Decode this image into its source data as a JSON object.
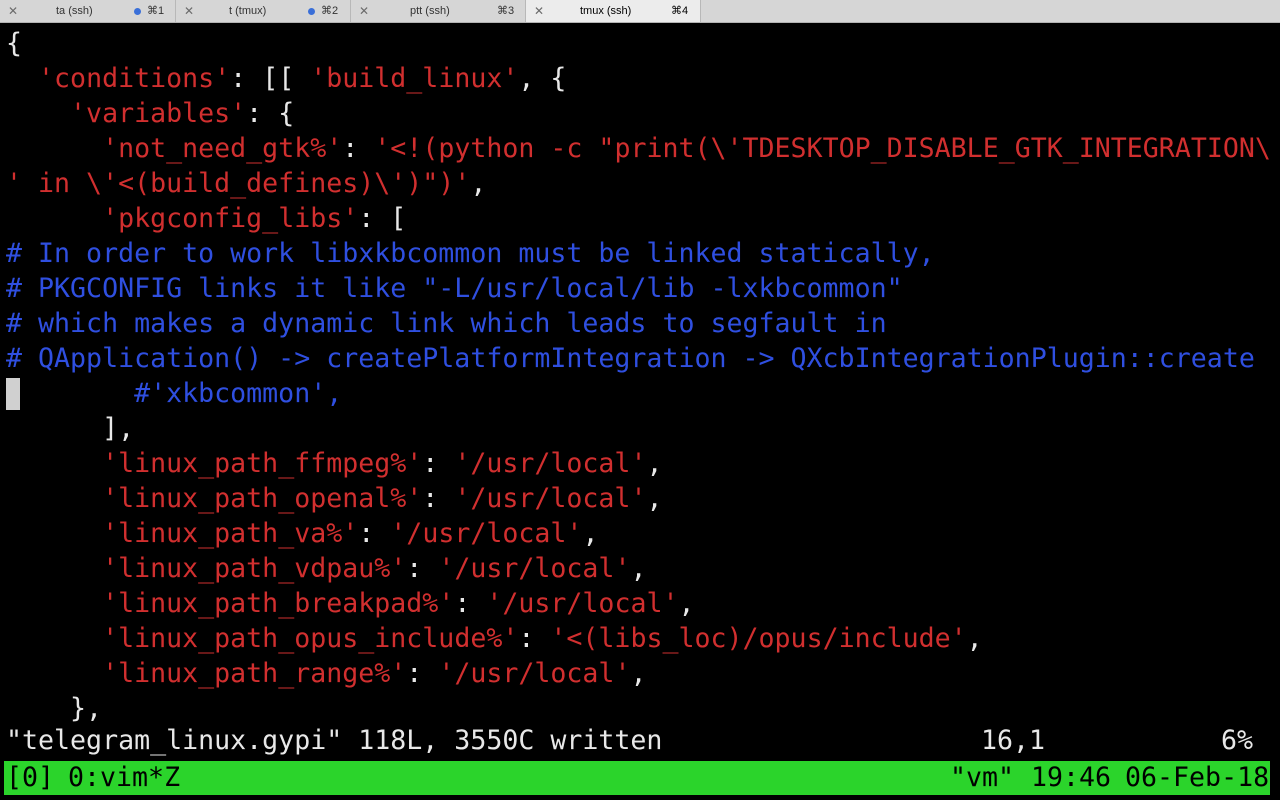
{
  "tabs": [
    {
      "title": "ta (ssh)",
      "shortcut": "⌘1",
      "dot": true
    },
    {
      "title": "t (tmux)",
      "shortcut": "⌘2",
      "dot": true
    },
    {
      "title": "ptt (ssh)",
      "shortcut": "⌘3",
      "dot": false
    },
    {
      "title": "tmux (ssh)",
      "shortcut": "⌘4",
      "dot": false,
      "active": true
    }
  ],
  "colors": {
    "string_red": "#d12f2f",
    "comment_blue": "#2f4fe0",
    "tmux_green": "#2bd42b",
    "tab_dot_blue": "#3a6fd8"
  },
  "icons": {
    "tab_close": "close-icon",
    "activity": "activity-dot-icon"
  },
  "editor": {
    "lines": [
      {
        "segments": [
          {
            "text": "{",
            "c": "white"
          }
        ]
      },
      {
        "segments": [
          {
            "text": "  ",
            "c": "white"
          },
          {
            "text": "'conditions'",
            "c": "red"
          },
          {
            "text": ": [[ ",
            "c": "white"
          },
          {
            "text": "'build_linux'",
            "c": "red"
          },
          {
            "text": ", {",
            "c": "white"
          }
        ]
      },
      {
        "segments": [
          {
            "text": "    ",
            "c": "white"
          },
          {
            "text": "'variables'",
            "c": "red"
          },
          {
            "text": ": {",
            "c": "white"
          }
        ]
      },
      {
        "segments": [
          {
            "text": "      ",
            "c": "white"
          },
          {
            "text": "'not_need_gtk%'",
            "c": "red"
          },
          {
            "text": ": ",
            "c": "white"
          },
          {
            "text": "'<!(python -c \"print(\\'TDESKTOP_DISABLE_GTK_INTEGRATION\\",
            "c": "red"
          }
        ]
      },
      {
        "segments": [
          {
            "text": "' in \\'<(build_defines)\\')\")'",
            "c": "red"
          },
          {
            "text": ",",
            "c": "white"
          }
        ]
      },
      {
        "segments": [
          {
            "text": "      ",
            "c": "white"
          },
          {
            "text": "'pkgconfig_libs'",
            "c": "red"
          },
          {
            "text": ": [",
            "c": "white"
          }
        ]
      },
      {
        "segments": [
          {
            "text": "# In order to work libxkbcommon must be linked statically,",
            "c": "blue"
          }
        ]
      },
      {
        "segments": [
          {
            "text": "# PKGCONFIG links it like \"-L/usr/local/lib -lxkbcommon\"",
            "c": "blue"
          }
        ]
      },
      {
        "segments": [
          {
            "text": "# which makes a dynamic link which leads to segfault in",
            "c": "blue"
          }
        ]
      },
      {
        "segments": [
          {
            "text": "# QApplication() -> createPlatformIntegration -> QXcbIntegrationPlugin::create",
            "c": "blue"
          }
        ]
      },
      {
        "segments": [
          {
            "text": "        #'xkbcommon',",
            "c": "blue"
          }
        ]
      },
      {
        "segments": [
          {
            "text": "      ],",
            "c": "white"
          }
        ]
      },
      {
        "segments": [
          {
            "text": "      ",
            "c": "white"
          },
          {
            "text": "'linux_path_ffmpeg%'",
            "c": "red"
          },
          {
            "text": ": ",
            "c": "white"
          },
          {
            "text": "'/usr/local'",
            "c": "red"
          },
          {
            "text": ",",
            "c": "white"
          }
        ]
      },
      {
        "segments": [
          {
            "text": "      ",
            "c": "white"
          },
          {
            "text": "'linux_path_openal%'",
            "c": "red"
          },
          {
            "text": ": ",
            "c": "white"
          },
          {
            "text": "'/usr/local'",
            "c": "red"
          },
          {
            "text": ",",
            "c": "white"
          }
        ]
      },
      {
        "segments": [
          {
            "text": "      ",
            "c": "white"
          },
          {
            "text": "'linux_path_va%'",
            "c": "red"
          },
          {
            "text": ": ",
            "c": "white"
          },
          {
            "text": "'/usr/local'",
            "c": "red"
          },
          {
            "text": ",",
            "c": "white"
          }
        ]
      },
      {
        "segments": [
          {
            "text": "      ",
            "c": "white"
          },
          {
            "text": "'linux_path_vdpau%'",
            "c": "red"
          },
          {
            "text": ": ",
            "c": "white"
          },
          {
            "text": "'/usr/local'",
            "c": "red"
          },
          {
            "text": ",",
            "c": "white"
          }
        ]
      },
      {
        "segments": [
          {
            "text": "      ",
            "c": "white"
          },
          {
            "text": "'linux_path_breakpad%'",
            "c": "red"
          },
          {
            "text": ": ",
            "c": "white"
          },
          {
            "text": "'/usr/local'",
            "c": "red"
          },
          {
            "text": ",",
            "c": "white"
          }
        ]
      },
      {
        "segments": [
          {
            "text": "      ",
            "c": "white"
          },
          {
            "text": "'linux_path_opus_include%'",
            "c": "red"
          },
          {
            "text": ": ",
            "c": "white"
          },
          {
            "text": "'<(libs_loc)/opus/include'",
            "c": "red"
          },
          {
            "text": ",",
            "c": "white"
          }
        ]
      },
      {
        "segments": [
          {
            "text": "      ",
            "c": "white"
          },
          {
            "text": "'linux_path_range%'",
            "c": "red"
          },
          {
            "text": ": ",
            "c": "white"
          },
          {
            "text": "'/usr/local'",
            "c": "red"
          },
          {
            "text": ",",
            "c": "white"
          }
        ]
      },
      {
        "segments": [
          {
            "text": "    },",
            "c": "white"
          }
        ]
      }
    ]
  },
  "statusline": {
    "message": "\"telegram_linux.gypi\" 118L, 3550C written",
    "position": "16,1",
    "percent": "6%"
  },
  "tmux": {
    "session": "[0]",
    "window": "0:vim*Z",
    "host": "\"vm\"",
    "time": "19:46",
    "date": "06-Feb-18"
  }
}
